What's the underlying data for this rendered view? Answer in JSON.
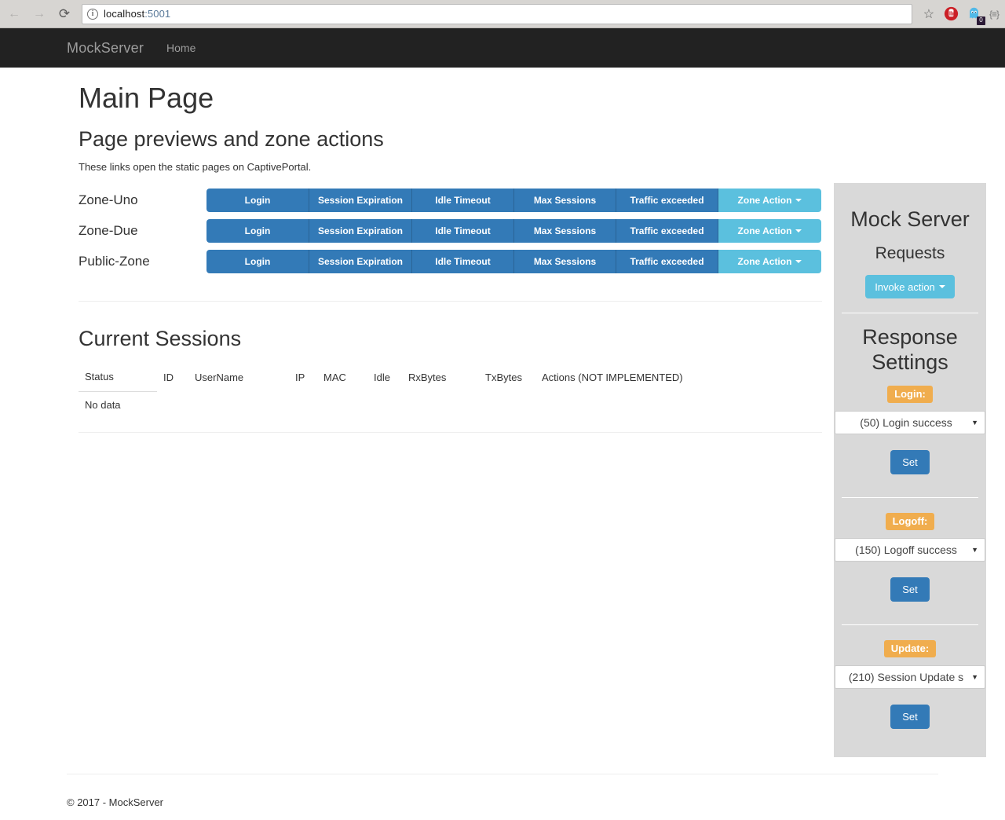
{
  "browser": {
    "back_icon": "back-arrow-icon",
    "forward_icon": "forward-arrow-icon",
    "reload_icon": "reload-icon",
    "info_icon_char": "i",
    "url_host": "localhost",
    "url_port": ":5001",
    "url_full": "localhost:5001",
    "bookmark_icon": "star-outline-icon",
    "extensions": [
      {
        "name": "ublock-origin-icon",
        "badge": ""
      },
      {
        "name": "ghostery-icon",
        "badge": "0"
      },
      {
        "name": "browser-menu-icon",
        "glyph": "{≡}"
      }
    ]
  },
  "navbar": {
    "brand": "MockServer",
    "links": [
      {
        "label": "Home"
      }
    ]
  },
  "page": {
    "title": "Main Page"
  },
  "previews": {
    "heading": "Page previews and zone actions",
    "description": "These links open the static pages on CaptivePortal.",
    "action_labels": [
      "Login",
      "Session Expiration",
      "Idle Timeout",
      "Max Sessions",
      "Traffic exceeded"
    ],
    "zone_action_label": "Zone Action",
    "zones": [
      {
        "name": "Zone-Uno"
      },
      {
        "name": "Zone-Due"
      },
      {
        "name": "Public-Zone"
      }
    ]
  },
  "sessions": {
    "heading": "Current Sessions",
    "columns": [
      "Status",
      "ID",
      "UserName",
      "IP",
      "MAC",
      "Idle",
      "RxBytes",
      "TxBytes",
      "Actions (NOT IMPLEMENTED)"
    ],
    "empty_text": "No data",
    "rows": []
  },
  "sidebar": {
    "title": "Mock Server",
    "requests_heading": "Requests",
    "invoke_label": "Invoke action",
    "response_settings_heading": "Response Settings",
    "sections": [
      {
        "badge": "Login:",
        "selected": "(50) Login success",
        "set_label": "Set"
      },
      {
        "badge": "Logoff:",
        "selected": "(150) Logoff success",
        "set_label": "Set"
      },
      {
        "badge": "Update:",
        "selected": "(210) Session Update s",
        "set_label": "Set"
      }
    ]
  },
  "footer": {
    "copyright": "© 2017 - MockServer"
  },
  "colors": {
    "navbar_bg": "#222222",
    "primary": "#337ab7",
    "info": "#5bc0de",
    "warning": "#f0ad4e",
    "sidebar_bg": "#d9d9d9"
  }
}
